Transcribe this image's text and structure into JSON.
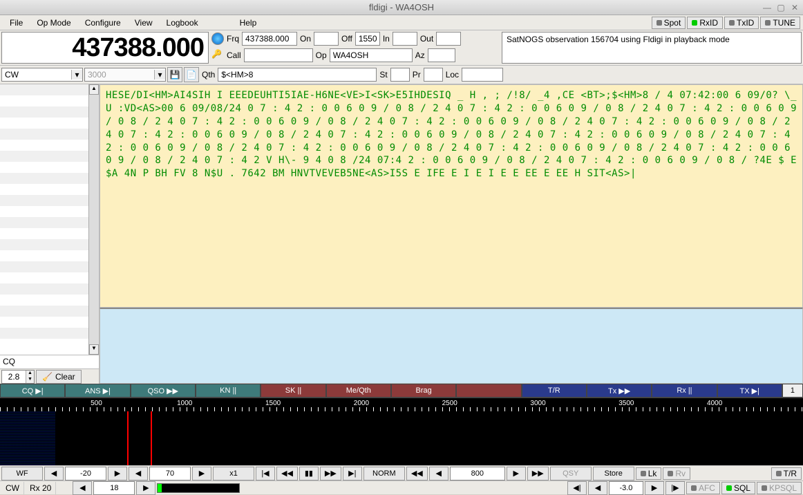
{
  "title": "fldigi - WA4OSH",
  "menu": {
    "file": "File",
    "opmode": "Op Mode",
    "configure": "Configure",
    "view": "View",
    "logbook": "Logbook",
    "help": "Help"
  },
  "topbtns": {
    "spot": "Spot",
    "rxid": "RxID",
    "txid": "TxID",
    "tune": "TUNE"
  },
  "freq_display": "437388.000",
  "fields": {
    "frq_label": "Frq",
    "frq": "437388.000",
    "on_label": "On",
    "on": "",
    "off_label": "Off",
    "off": "1550",
    "in_label": "In",
    "in": "",
    "out_label": "Out",
    "out": "",
    "call_label": "Call",
    "call": "",
    "op_label": "Op",
    "op": "WA4OSH",
    "az_label": "Az",
    "az": "",
    "qth_label": "Qth",
    "qth": "$<HM>8",
    "st_label": "St",
    "st": "",
    "pr_label": "Pr",
    "pr": "",
    "loc_label": "Loc",
    "loc": ""
  },
  "notes": "SatNOGS observation 156704 using Fldigi in playback mode",
  "mode": "CW",
  "bandwidth": "3000",
  "cq": "CQ",
  "wpm": "2.8",
  "clear": "Clear",
  "rx_text": "HESE/DI<HM>AI4SIH I EEEDEUHTI5IAE-H6NE<VE>I<SK>E5IHDESIQ _ H , ; /!8/ _4 ,CE <BT>;$<HM>8 / 4 07:42:00 6 09/0? \\_U :VD<AS>00 6 09/08/24 0 7 : 4 2 : 0 0 6 0 9 / 0 8 / 2 4 0 7 : 4 2 : 0 0 6 0 9 / 0 8 / 2 4 0 7 : 4 2 : 0 0 6 0 9 / 0 8 / 2 4 0 7 : 4 2 : 0 0 6 0 9 / 0 8 / 2 4 0 7 : 4 2 : 0 0 6 0 9 / 0 8 / 2 4 0 7 : 4 2 : 0 0 6 0 9 / 0 8 / 2 4 0 7 : 4 2 : 0 0 6 0 9 / 0 8 / 2 4 0 7 : 4 2 : 0 0 6 0 9 / 0 8 / 2 4 0 7 : 4 2 : 0 0 6 0 9 / 0 8 / 2 4 0 7 : 4 2 : 0 0 6 0 9 / 0 8 / 2 4 0 7 : 4 2 : 0 0 6 0 9 / 0 8 / 2 4 0 7 : 4 2 : 0 0 6 0 9 / 0 8 / 2 4 0 7 : 4 2 : 0 0 6 0 9 / 0 8 / 2 4 0 7 : 4 2 V H\\- 9 4 0 8 /24 07:4 2 : 0 0 6 0 9 / 0 8 / 2 4 0 7 : 4 2 : 0 0 6 0 9 / 0 8 / ?4E $ E$A 4N P BH FV 8 N$U . 7642 BM HNVTVEVEB5NE<AS>I5S E IFE E I E I E E EE E EE H SIT<AS>|",
  "macros": {
    "cq": "CQ ▶|",
    "ans": "ANS ▶|",
    "qso": "QSO ▶▶",
    "kn": "KN ||",
    "sk": "SK ||",
    "meqth": "Me/Qth",
    "brag": "Brag",
    "empty": "",
    "tr": "T/R",
    "tx": "Tx ▶▶",
    "rx": "Rx ||",
    "tx2": "TX ▶|",
    "num": "1"
  },
  "ruler_ticks": [
    500,
    1000,
    1500,
    2000,
    2500,
    3000,
    3500,
    4000
  ],
  "bottom": {
    "wf": "WF",
    "lvl": "-20",
    "speed": "70",
    "zoom": "x1",
    "norm": "NORM",
    "freq": "800",
    "qsy": "QSY",
    "store": "Store",
    "lk": "Lk",
    "rv": "Rv",
    "tr": "T/R"
  },
  "status": {
    "mode": "CW",
    "rx": "Rx 20",
    "wpm": "18",
    "sig": "-3.0",
    "afc": "AFC",
    "sql": "SQL",
    "kpsql": "KPSQL"
  }
}
